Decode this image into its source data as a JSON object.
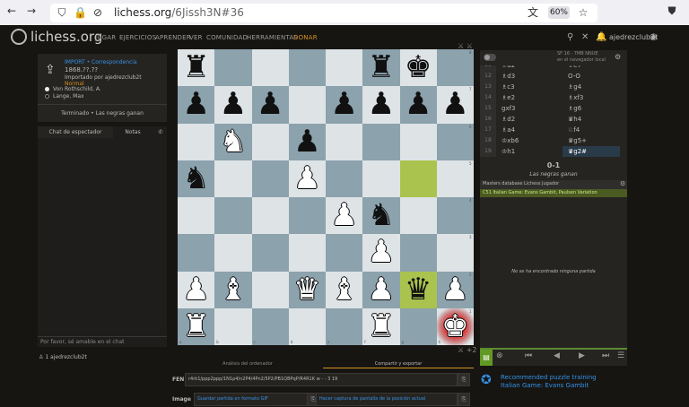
{
  "browser": {
    "url_domain": "lichess.org",
    "url_path": "/6Jissh3N#36",
    "zoom": "60%"
  },
  "header": {
    "logo_text": "lichess.org",
    "nav": [
      "JUGAR",
      "EJERCICIOS",
      "APRENDER",
      "VER",
      "COMUNIDAD",
      "HERRAMIENTAS",
      "DONAR"
    ],
    "username": "ajedrezclub2t"
  },
  "game": {
    "title": "IMPORT • Correspondencia",
    "date": "1868.??.??",
    "imported_by": "Importado por ajedrezclub2t",
    "variant": "Normal",
    "players": [
      {
        "name": "Von Rothschild, A.",
        "color": "white"
      },
      {
        "name": "Lange, Max",
        "color": "black"
      }
    ],
    "status": "Terminado • Las negras ganan"
  },
  "chat": {
    "tabs": [
      "Chat de espectador",
      "Notas"
    ],
    "placeholder": "Por favor, sé amable en el chat",
    "spectators": "1  ajedrezclub2t"
  },
  "board": {
    "files": [
      "a",
      "b",
      "c",
      "d",
      "e",
      "f",
      "g",
      "h"
    ],
    "ranks": [
      "8",
      "7",
      "6",
      "5",
      "4",
      "3",
      "2",
      "1"
    ],
    "position": [
      [
        "r",
        "",
        "",
        "",
        "",
        "r",
        "k",
        ""
      ],
      [
        "p",
        "p",
        "p",
        "",
        "p",
        "p",
        "p",
        "p"
      ],
      [
        "",
        "N",
        "",
        "p",
        "",
        "",
        "",
        ""
      ],
      [
        "n",
        "",
        "",
        "P",
        "",
        "",
        "",
        ""
      ],
      [
        "",
        "",
        "",
        "",
        "P",
        "n",
        "",
        ""
      ],
      [
        "",
        "",
        "",
        "",
        "",
        "P",
        "",
        ""
      ],
      [
        "P",
        "B",
        "",
        "Q",
        "B",
        "P",
        "q",
        "P"
      ],
      [
        "R",
        "",
        "",
        "",
        "",
        "R",
        "",
        "K"
      ]
    ],
    "highlight_squares": [
      "g5",
      "g2"
    ],
    "check_square": "h1",
    "icons_top": "⚔ ⚔",
    "icons_bottom": "⚔ +2"
  },
  "engine": {
    "name": "SF 16 · 7MB  NNUE",
    "subtitle": "en el navegador local"
  },
  "moves": [
    {
      "no": "11",
      "white": "♗d2",
      "black": "♗e7"
    },
    {
      "no": "12",
      "white": "♗d3",
      "black": "O-O"
    },
    {
      "no": "13",
      "white": "♗c3",
      "black": "♗g4"
    },
    {
      "no": "14",
      "white": "♗e2",
      "black": "♗xf3"
    },
    {
      "no": "15",
      "white": "gxf3",
      "black": "♗g6"
    },
    {
      "no": "16",
      "white": "♗d2",
      "black": "♛h4"
    },
    {
      "no": "17",
      "white": "♗a4",
      "black": "♘f4"
    },
    {
      "no": "18",
      "white": "♔xb6",
      "black": "♛g5+"
    },
    {
      "no": "19",
      "white": "♔h1",
      "black": "♛g2#"
    }
  ],
  "active_move": "♛g2#",
  "result": {
    "score": "0-1",
    "text": "Las negras ganan"
  },
  "explorer": {
    "tabs": "Masters  database  Lichess  Jugador",
    "opening": "C51 Italian Game: Evans Gambit, Paulsen Variation",
    "empty": "No se ha encontrado ninguna partida"
  },
  "bottom": {
    "tabs": [
      "Análisis del ordenador",
      "Compartir y exportar"
    ],
    "fen_label": "FEN",
    "fen": "r4rk1/ppp2ppp/1N1p4/n2P4/4Pn2/5P2/PB1QBPqP/R4R1K w - - 3 19",
    "image_label": "Image",
    "gif_link": "Guardar partida en formato GIF",
    "screenshot_link": "Hacer captura de pantalla de la posición actual"
  },
  "puzzle": {
    "line1": "Recommended puzzle training",
    "line2": "Italian Game: Evans Gambit"
  }
}
